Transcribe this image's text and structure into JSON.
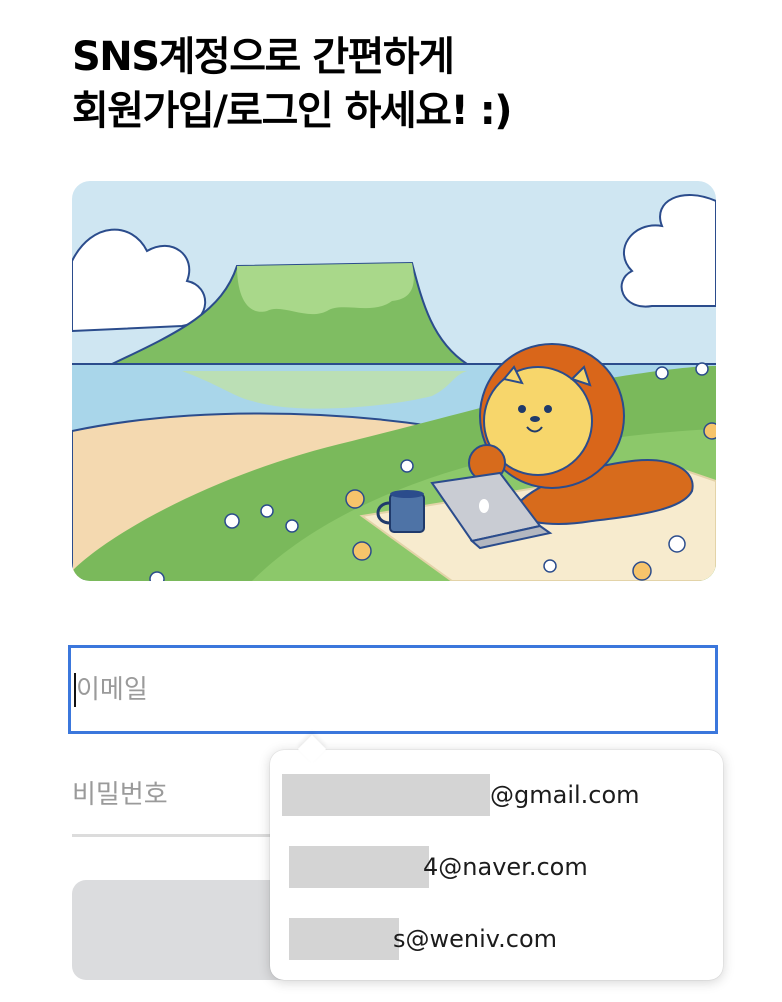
{
  "heading": {
    "line1": "SNS계정으로 간편하게",
    "line2": "회원가입/로그인 하세요! :)"
  },
  "form": {
    "email_placeholder": "이메일",
    "password_placeholder": "비밀번호",
    "login_button_label": ""
  },
  "autofill": {
    "items": [
      {
        "domain": "@gmail.com"
      },
      {
        "domain": "4@naver.com"
      },
      {
        "domain": "s@weniv.com"
      }
    ]
  },
  "colors": {
    "focus_border": "#3b77dc",
    "button_bg": "#dbdcde",
    "placeholder": "#9a9a9a"
  },
  "icons": {
    "illustration": "lion-laptop-island-illustration"
  }
}
